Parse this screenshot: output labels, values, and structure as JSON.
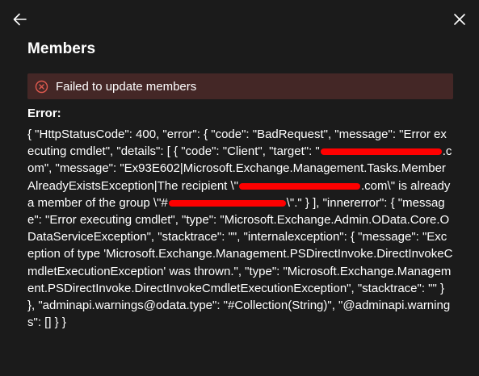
{
  "header": {
    "back_icon": "arrow-left-icon",
    "close_icon": "close-icon",
    "title": "Members"
  },
  "notification": {
    "icon": "error-circle-icon",
    "message": "Failed to update members",
    "icon_color": "#e05a4f",
    "background": "#442726"
  },
  "error": {
    "label": "Error:",
    "part1": "{ \"HttpStatusCode\": 400, \"error\": { \"code\": \"BadRequest\", \"message\": \"Error executing cmdlet\", \"details\": [ { \"code\": \"Client\", \"target\": \"",
    "part2": ".com\", \"message\": \"Ex93E602|Microsoft.Exchange.Management.Tasks.MemberAlreadyExistsException|The recipient \\\"",
    "part3": ".com\\\" is already a member of the group \\\"#",
    "part4": "\\\".\" } ], \"innererror\": { \"message\": \"Error executing cmdlet\", \"type\": \"Microsoft.Exchange.Admin.OData.Core.ODataServiceException\", \"stacktrace\": \"\", \"internalexception\": { \"message\": \"Exception of type 'Microsoft.Exchange.Management.PSDirectInvoke.DirectInvokeCmdletExecutionException' was thrown.\", \"type\": \"Microsoft.Exchange.Management.PSDirectInvoke.DirectInvokeCmdletExecutionException\", \"stacktrace\": \"\" } }, \"adminapi.warnings@odata.type\": \"#Collection(String)\", \"@adminapi.warnings\": [] } }",
    "redaction_color": "#ff0000"
  }
}
